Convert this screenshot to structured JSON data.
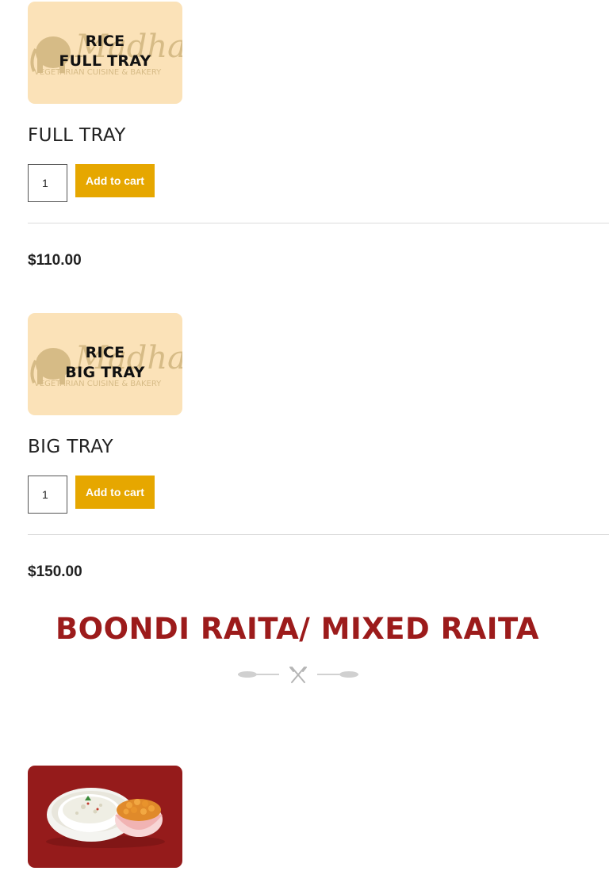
{
  "products": [
    {
      "thumb_line1": "RICE",
      "thumb_line2": "FULL TRAY",
      "title": "FULL TRAY",
      "qty": "1",
      "add_label": "Add to cart",
      "price": "$110.00"
    },
    {
      "thumb_line1": "RICE",
      "thumb_line2": "BIG TRAY",
      "title": "BIG TRAY",
      "qty": "1",
      "add_label": "Add to cart",
      "price": "$150.00"
    }
  ],
  "section": {
    "heading": "BOONDI RAITA/ MIXED RAITA"
  },
  "watermark": {
    "logo_text": "Madhan",
    "tagline": "VEGETARIAN CUISINE & BAKERY"
  },
  "colors": {
    "accent": "#e6a700",
    "heading": "#9c1b1b",
    "thumb_bg": "#fbe2b8",
    "raita_bg": "#951b1b"
  },
  "icons": {
    "ornament": "fork-knife-divider-icon"
  }
}
